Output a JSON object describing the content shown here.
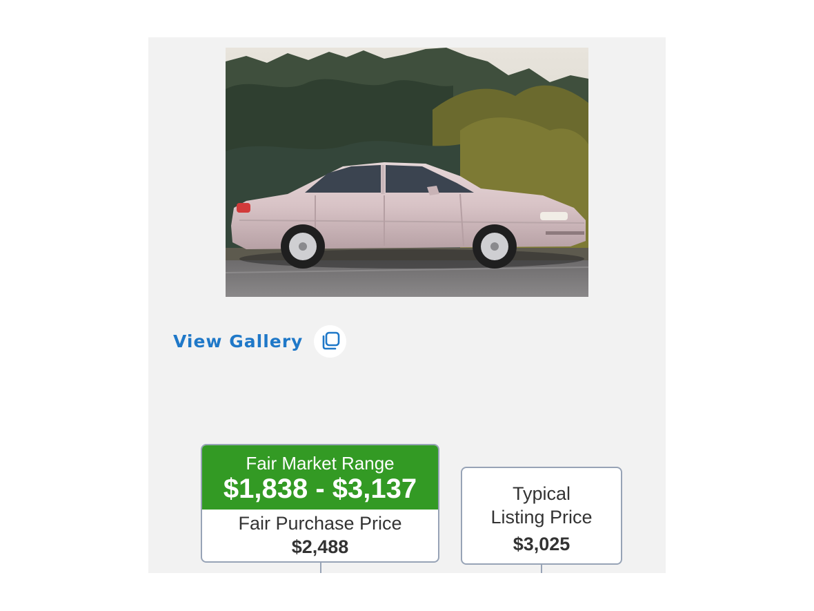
{
  "photo": {
    "alt": "Silver four-door sedan parked on a road in front of a forested hillside",
    "icon": "car-photo"
  },
  "gallery": {
    "label": "View Gallery",
    "icon": "gallery-copy-icon",
    "color": "#1f78c8"
  },
  "fair_market": {
    "title": "Fair Market Range",
    "range": "$1,838 - $3,137",
    "purchase_label": "Fair Purchase Price",
    "purchase_value": "$2,488",
    "accent_color": "#339a24"
  },
  "typical_listing": {
    "label_line1": "Typical",
    "label_line2": "Listing Price",
    "value": "$3,025"
  }
}
